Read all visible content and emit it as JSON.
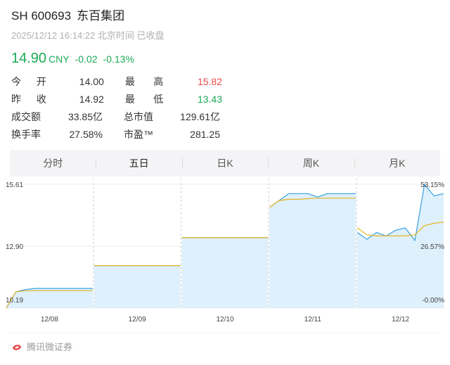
{
  "header": {
    "code": "SH 600693",
    "name": "东百集团",
    "time": "2025/12/12 16:14:22 北京时间 已收盘",
    "price": "14.90",
    "currency": "CNY",
    "change": "-0.02",
    "change_pct": "-0.13%"
  },
  "stats": {
    "open_label": "今开",
    "open_value": "14.00",
    "high_label": "最高",
    "high_value": "15.82",
    "prev_close_label": "昨收",
    "prev_close_value": "14.92",
    "low_label": "最低",
    "low_value": "13.43",
    "volume_label": "成交额",
    "volume_value": "33.85亿",
    "market_cap_label": "总市值",
    "market_cap_value": "129.61亿",
    "turnover_label": "换手率",
    "turnover_value": "27.58%",
    "pe_label": "市盈™",
    "pe_value": "281.25"
  },
  "tabs": [
    "分时",
    "五日",
    "日K",
    "周K",
    "月K"
  ],
  "active_tab": 1,
  "colors": {
    "up": "#e84a4a",
    "down": "#1aaa55",
    "price_line": "#3aa0e0",
    "avg_line": "#e6b422",
    "fill": "#d6ecfb"
  },
  "chart_data": {
    "type": "line",
    "ylim": [
      10.19,
      15.61
    ],
    "y_ticks_left": [
      "15.61",
      "12.90",
      "10.19"
    ],
    "y_ticks_right": [
      "53.15%",
      "26.57%",
      "-0.00%"
    ],
    "x_labels": [
      "12/08",
      "12/09",
      "12/10",
      "12/11",
      "12/12"
    ],
    "series": [
      {
        "values": [
          10.2,
          10.9,
          11.0,
          11.05,
          11.05,
          11.05,
          11.05,
          11.05,
          11.05,
          11.05,
          12.05,
          12.05,
          12.05,
          12.05,
          12.05,
          12.05,
          12.05,
          12.05,
          12.05,
          12.05,
          13.27,
          13.27,
          13.27,
          13.27,
          13.27,
          13.27,
          13.27,
          13.27,
          13.27,
          13.27,
          14.6,
          14.9,
          15.2,
          15.2,
          15.2,
          15.05,
          15.2,
          15.2,
          15.2,
          15.2,
          13.5,
          13.2,
          13.5,
          13.35,
          13.6,
          13.7,
          13.15,
          15.6,
          15.1,
          15.2
        ]
      },
      {
        "values": [
          10.19,
          10.9,
          10.95,
          10.95,
          10.95,
          10.95,
          10.95,
          10.95,
          10.95,
          10.95,
          12.05,
          12.05,
          12.05,
          12.05,
          12.05,
          12.05,
          12.05,
          12.05,
          12.05,
          12.05,
          13.27,
          13.27,
          13.27,
          13.27,
          13.27,
          13.27,
          13.27,
          13.27,
          13.27,
          13.27,
          14.6,
          14.9,
          14.95,
          14.95,
          14.98,
          15.0,
          15.0,
          15.0,
          15.0,
          15.0,
          13.7,
          13.4,
          13.35,
          13.35,
          13.35,
          13.35,
          13.4,
          13.8,
          13.9,
          13.95
        ]
      }
    ]
  },
  "footer": {
    "source": "腾讯微证券"
  }
}
